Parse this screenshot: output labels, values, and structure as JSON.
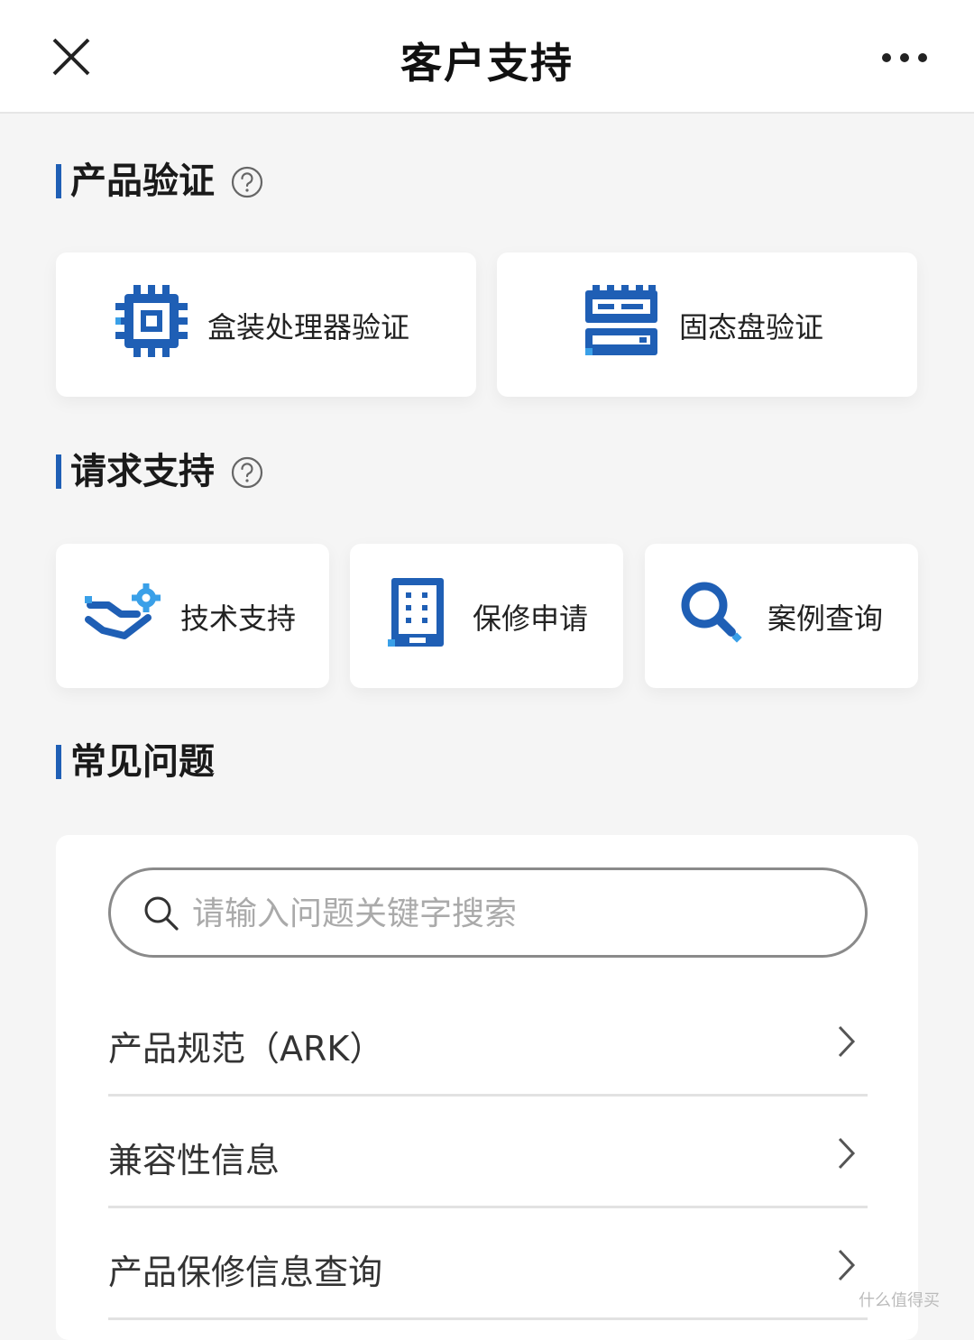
{
  "header": {
    "title": "客户支持",
    "close_icon": "close-icon",
    "more_icon": "more-icon"
  },
  "sections": {
    "product_verification": {
      "title": "产品验证",
      "cards": [
        {
          "label": "盒装处理器验证",
          "icon": "cpu-chip-icon"
        },
        {
          "label": "固态盘验证",
          "icon": "ssd-drive-icon"
        }
      ]
    },
    "request_support": {
      "title": "请求支持",
      "cards": [
        {
          "label": "技术支持",
          "icon": "hand-gear-icon"
        },
        {
          "label": "保修申请",
          "icon": "building-icon"
        },
        {
          "label": "案例查询",
          "icon": "search-icon"
        }
      ]
    },
    "faq": {
      "title": "常见问题",
      "search_placeholder": "请输入问题关键字搜索",
      "items": [
        {
          "label": "产品规范（ARK）"
        },
        {
          "label": "兼容性信息"
        },
        {
          "label": "产品保修信息查询"
        }
      ]
    }
  },
  "watermark": "什么值得买",
  "colors": {
    "accent": "#1f5fb5",
    "accent_light": "#3aa0e8",
    "background": "#f5f5f5"
  }
}
